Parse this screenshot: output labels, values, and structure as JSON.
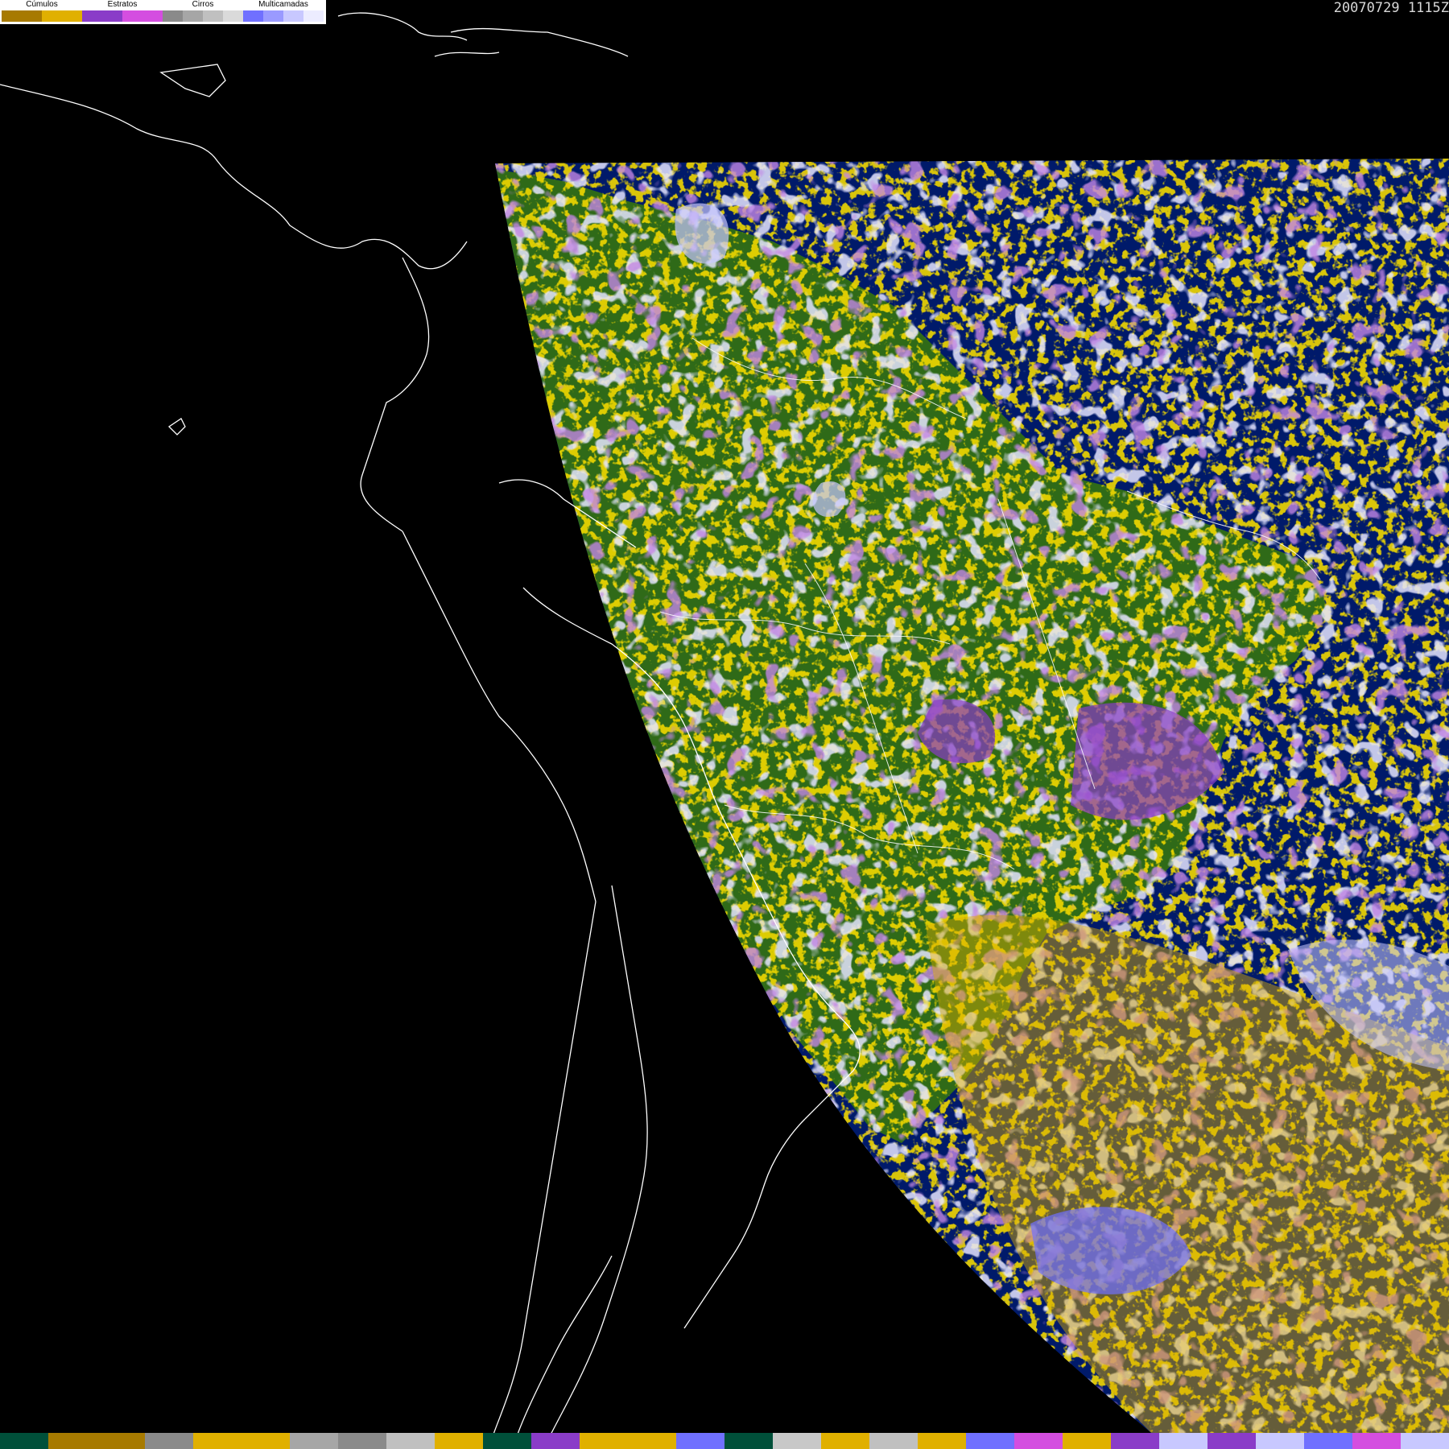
{
  "legend": {
    "groups": [
      {
        "label": "Cúmulos",
        "colors": [
          "#a77a00",
          "#e0b000"
        ]
      },
      {
        "label": "Estratos",
        "colors": [
          "#8a3cc8",
          "#d44ee0"
        ]
      },
      {
        "label": "Cirros",
        "colors": [
          "#8a8a8a",
          "#a6a6a6",
          "#c0c0c0",
          "#dadada"
        ]
      },
      {
        "label": "Multicamadas",
        "colors": [
          "#7070ff",
          "#9a9aff",
          "#c8c8ff",
          "#ececff"
        ]
      }
    ]
  },
  "timestamp": "20070729 1115Z",
  "bottom_bar": {
    "colors": [
      "#00503a",
      "#a77a00",
      "#a77a00",
      "#8a8a8a",
      "#e0b000",
      "#e0b000",
      "#a6a6a6",
      "#8a8a8a",
      "#c0c0c0",
      "#e0b000",
      "#00503a",
      "#8a3cc8",
      "#e0b000",
      "#e0b000",
      "#7070ff",
      "#00503a",
      "#c8c8c8",
      "#e0b000",
      "#c0c0c0",
      "#e0b000",
      "#7070ff",
      "#d44ee0",
      "#e0b000",
      "#8a3cc8",
      "#c8c8ff",
      "#8a3cc8",
      "#c8c8ff",
      "#7070ff",
      "#d44ee0",
      "#c8c8ff"
    ]
  },
  "colors": {
    "background": "#000000",
    "ocean": "#001a6a",
    "land": "#2f6a18",
    "coastline": "#ffffff"
  }
}
